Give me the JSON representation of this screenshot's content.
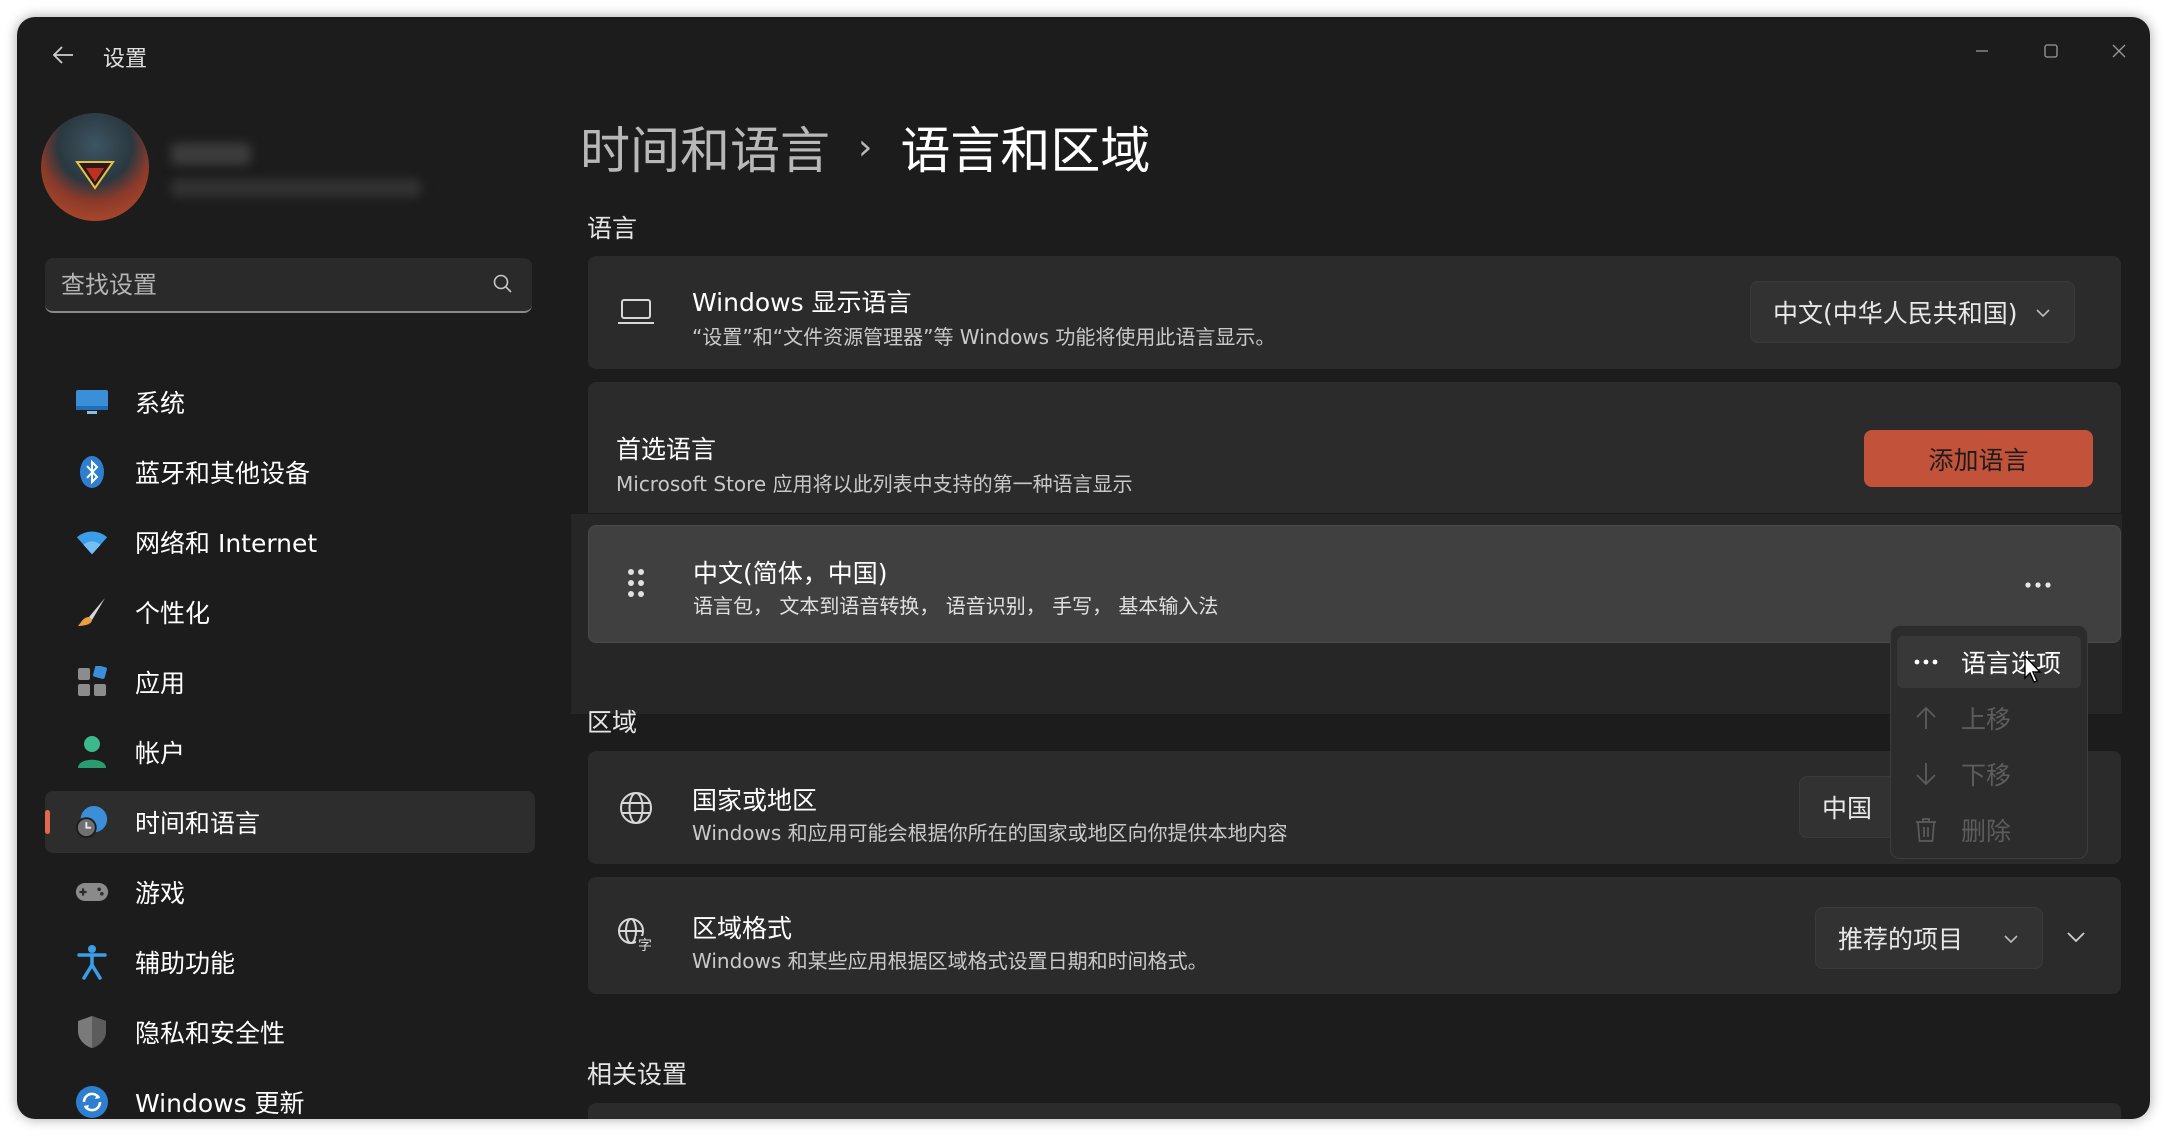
{
  "window": {
    "title": "设置"
  },
  "search": {
    "placeholder": "查找设置"
  },
  "sidebar": {
    "items": [
      {
        "label": "系统",
        "icon": "monitor-icon"
      },
      {
        "label": "蓝牙和其他设备",
        "icon": "bluetooth-icon"
      },
      {
        "label": "网络和 Internet",
        "icon": "wifi-icon"
      },
      {
        "label": "个性化",
        "icon": "brush-icon"
      },
      {
        "label": "应用",
        "icon": "apps-icon"
      },
      {
        "label": "帐户",
        "icon": "person-icon"
      },
      {
        "label": "时间和语言",
        "icon": "clock-globe-icon",
        "active": true
      },
      {
        "label": "游戏",
        "icon": "gamepad-icon"
      },
      {
        "label": "辅助功能",
        "icon": "accessibility-icon"
      },
      {
        "label": "隐私和安全性",
        "icon": "shield-icon"
      },
      {
        "label": "Windows 更新",
        "icon": "update-icon"
      }
    ]
  },
  "breadcrumb": {
    "parent": "时间和语言",
    "separator": "›",
    "current": "语言和区域"
  },
  "sections": {
    "language": "语言",
    "region": "区域",
    "related": "相关设置"
  },
  "display_language": {
    "title": "Windows 显示语言",
    "subtitle": "“设置”和“文件资源管理器”等 Windows 功能将使用此语言显示。",
    "value": "中文(中华人民共和国)"
  },
  "preferred_language": {
    "title": "首选语言",
    "subtitle": "Microsoft Store 应用将以此列表中支持的第一种语言显示",
    "add_button": "添加语言"
  },
  "language_item": {
    "title": "中文(简体，中国)",
    "features": "语言包， 文本到语音转换， 语音识别， 手写， 基本输入法"
  },
  "context_menu": {
    "items": [
      {
        "label": "语言选项",
        "enabled": true
      },
      {
        "label": "上移",
        "enabled": false
      },
      {
        "label": "下移",
        "enabled": false
      },
      {
        "label": "删除",
        "enabled": false
      }
    ]
  },
  "country_region": {
    "title": "国家或地区",
    "subtitle": "Windows 和应用可能会根据你所在的国家或地区向你提供本地内容",
    "value": "中国"
  },
  "regional_format": {
    "title": "区域格式",
    "subtitle": "Windows 和某些应用根据区域格式设置日期和时间格式。",
    "value": "推荐的项目"
  },
  "colors": {
    "accent": "#c2533a",
    "background": "#1c1c1c",
    "card": "#2b2b2b"
  }
}
